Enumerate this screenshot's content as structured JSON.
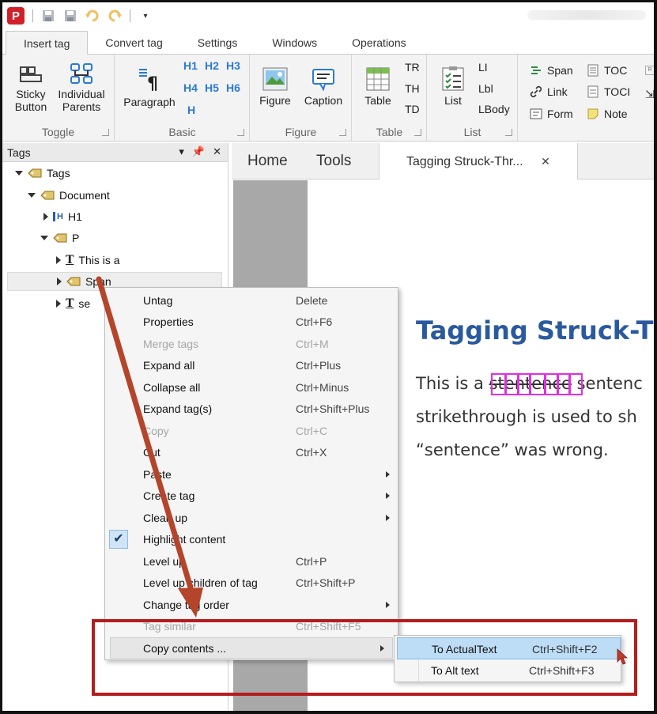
{
  "qat": {
    "app_logo_letter": "P",
    "icons": [
      "save-icon",
      "save-all-icon",
      "undo-icon",
      "redo-icon",
      "customize-icon"
    ]
  },
  "ribbon_tabs": [
    "Insert tag",
    "Convert tag",
    "Settings",
    "Windows",
    "Operations"
  ],
  "ribbon": {
    "toggle": {
      "label": "Toggle",
      "sticky": "Sticky Button",
      "sticky_l1": "Sticky",
      "sticky_l2": "Button",
      "indiv_l1": "Individual",
      "indiv_l2": "Parents"
    },
    "basic": {
      "label": "Basic",
      "paragraph": "Paragraph",
      "headings": [
        "H1",
        "H2",
        "H3",
        "H4",
        "H5",
        "H6",
        "H"
      ]
    },
    "figure": {
      "label": "Figure",
      "figure": "Figure",
      "caption": "Caption"
    },
    "table": {
      "label": "Table",
      "table": "Table",
      "tr": "TR",
      "th": "TH",
      "td": "TD"
    },
    "list": {
      "label": "List",
      "list": "List",
      "li": "LI",
      "lbl": "Lbl",
      "lbody": "LBody"
    },
    "misc": {
      "span": "Span",
      "link": "Link",
      "form": "Form",
      "toc": "TOC",
      "toci": "TOCI",
      "note": "Note"
    }
  },
  "tags_panel": {
    "title": "Tags",
    "tree": {
      "root": "Tags",
      "document": "Document",
      "h1": "H1",
      "p": "P",
      "text1": "This is a",
      "span": "Span",
      "text2": "se"
    }
  },
  "doc_tabs": {
    "home": "Home",
    "tools": "Tools",
    "file": "Tagging Struck-Thr..."
  },
  "document": {
    "title": "Tagging Struck-T",
    "line1_before": "This is a ",
    "line1_struck": "stentence",
    "line1_after": " sentenc",
    "line2": "strikethrough is used to sh",
    "line3": "“sentence” was wrong."
  },
  "context_menu": {
    "items": [
      {
        "label": "Untag",
        "shortcut": "Delete"
      },
      {
        "label": "Properties",
        "shortcut": "Ctrl+F6"
      },
      {
        "label": "Merge tags",
        "shortcut": "Ctrl+M"
      },
      {
        "label": "Expand all",
        "shortcut": "Ctrl+Plus"
      },
      {
        "label": "Collapse all",
        "shortcut": "Ctrl+Minus"
      },
      {
        "label": "Expand tag(s)",
        "shortcut": "Ctrl+Shift+Plus"
      },
      {
        "label": "Copy",
        "shortcut": "Ctrl+C"
      },
      {
        "label": "Cut",
        "shortcut": "Ctrl+X"
      },
      {
        "label": "Paste",
        "shortcut": ""
      },
      {
        "label": "Create tag",
        "shortcut": ""
      },
      {
        "label": "Clean up",
        "shortcut": ""
      },
      {
        "label": "Highlight content",
        "shortcut": ""
      },
      {
        "label": "Level up",
        "shortcut": "Ctrl+P"
      },
      {
        "label": "Level up children of tag",
        "shortcut": "Ctrl+Shift+P"
      },
      {
        "label": "Change tag order",
        "shortcut": ""
      },
      {
        "label": "Tag similar",
        "shortcut": "Ctrl+Shift+F5"
      },
      {
        "label": "Copy contents ...",
        "shortcut": ""
      }
    ]
  },
  "submenu": {
    "items": [
      {
        "label": "To ActualText",
        "shortcut": "Ctrl+Shift+F2"
      },
      {
        "label": "To Alt text",
        "shortcut": "Ctrl+Shift+F3"
      }
    ]
  },
  "colors": {
    "annotation_red": "#b51d1d",
    "arrow": "#b5452a",
    "highlight_magenta": "#e22fe0",
    "heading_blue": "#2a5a9e"
  }
}
